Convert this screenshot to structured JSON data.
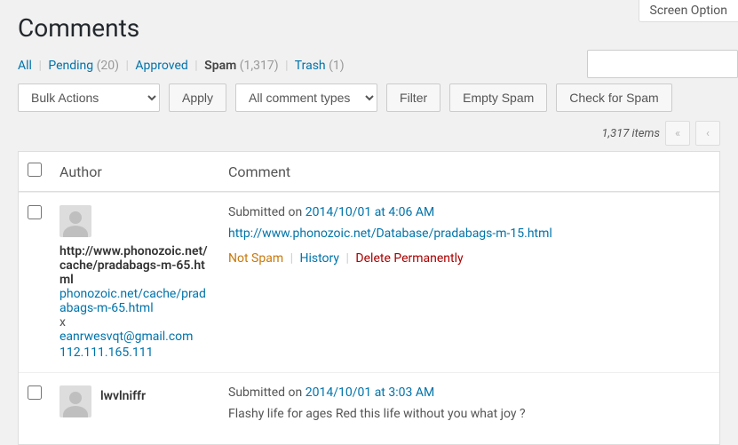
{
  "screen_options": "Screen Option",
  "page_title": "Comments",
  "filters": {
    "all": "All",
    "pending": {
      "label": "Pending",
      "count": "(20)"
    },
    "approved": "Approved",
    "spam": {
      "label": "Spam",
      "count": "(1,317)"
    },
    "trash": {
      "label": "Trash",
      "count": "(1)"
    }
  },
  "bulk_actions_label": "Bulk Actions",
  "apply_label": "Apply",
  "comment_types_label": "All comment types",
  "filter_label": "Filter",
  "empty_spam_label": "Empty Spam",
  "check_spam_label": "Check for Spam",
  "items_count": "1,317 items",
  "headers": {
    "author": "Author",
    "comment": "Comment"
  },
  "submitted_prefix": "Submitted on ",
  "actions": {
    "notspam": "Not Spam",
    "history": "History",
    "delete": "Delete Permanently"
  },
  "search_placeholder": "",
  "comments": [
    {
      "author_name": "http://www.phonozoic.net/cache/pradabags-m-65.html",
      "author_url": "phonozoic.net/cache/pradabags-m-65.html",
      "unsubscribe": "x",
      "author_email": "eanrwesvqt@gmail.com",
      "author_ip": "112.111.165.111",
      "date": "2014/10/01 at 4:06 AM",
      "content_link": "http://www.phonozoic.net/Database/pradabags-m-15.html"
    },
    {
      "author_name": "lwvlniffr",
      "date": "2014/10/01 at 3:03 AM",
      "content_text": "Flashy life for ages   Red this life without you what joy ?"
    }
  ]
}
